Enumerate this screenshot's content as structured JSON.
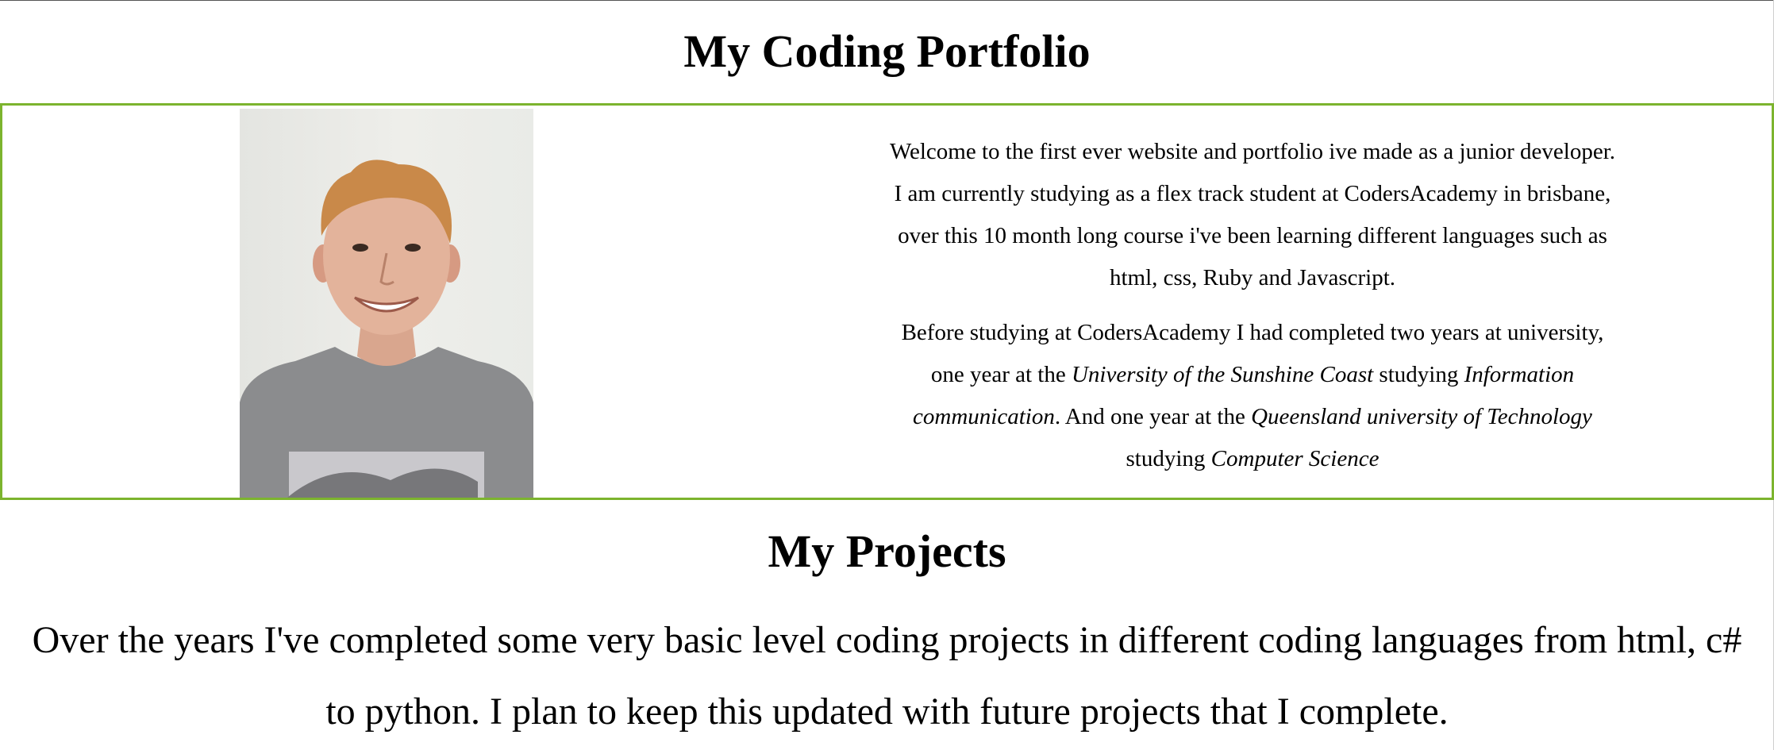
{
  "header": {
    "title": "My Coding Portfolio"
  },
  "about": {
    "photo_icon": "portrait-photo",
    "border_color": "#7cb42e",
    "paragraph1": "Welcome to the first ever website and portfolio ive made as a junior developer. I am currently studying as a flex track student at CodersAcademy in brisbane, over this 10 month long course i've been learning different languages such as html, css, Ruby and Javascript.",
    "paragraph2": {
      "t1": "Before studying at CodersAcademy I had completed two years at university, one year at the ",
      "em1": "University of the Sunshine Coast",
      "t2": " studying ",
      "em2": "Information communication",
      "t3": ". And one year at the ",
      "em3": "Queensland university of Technology",
      "t4": " studying ",
      "em4": "Computer Science"
    }
  },
  "projects": {
    "title": "My Projects",
    "text": "Over the years I've completed some very basic level coding projects in different coding languages from html, c# to python. I plan to keep this updated with future projects that I complete."
  }
}
